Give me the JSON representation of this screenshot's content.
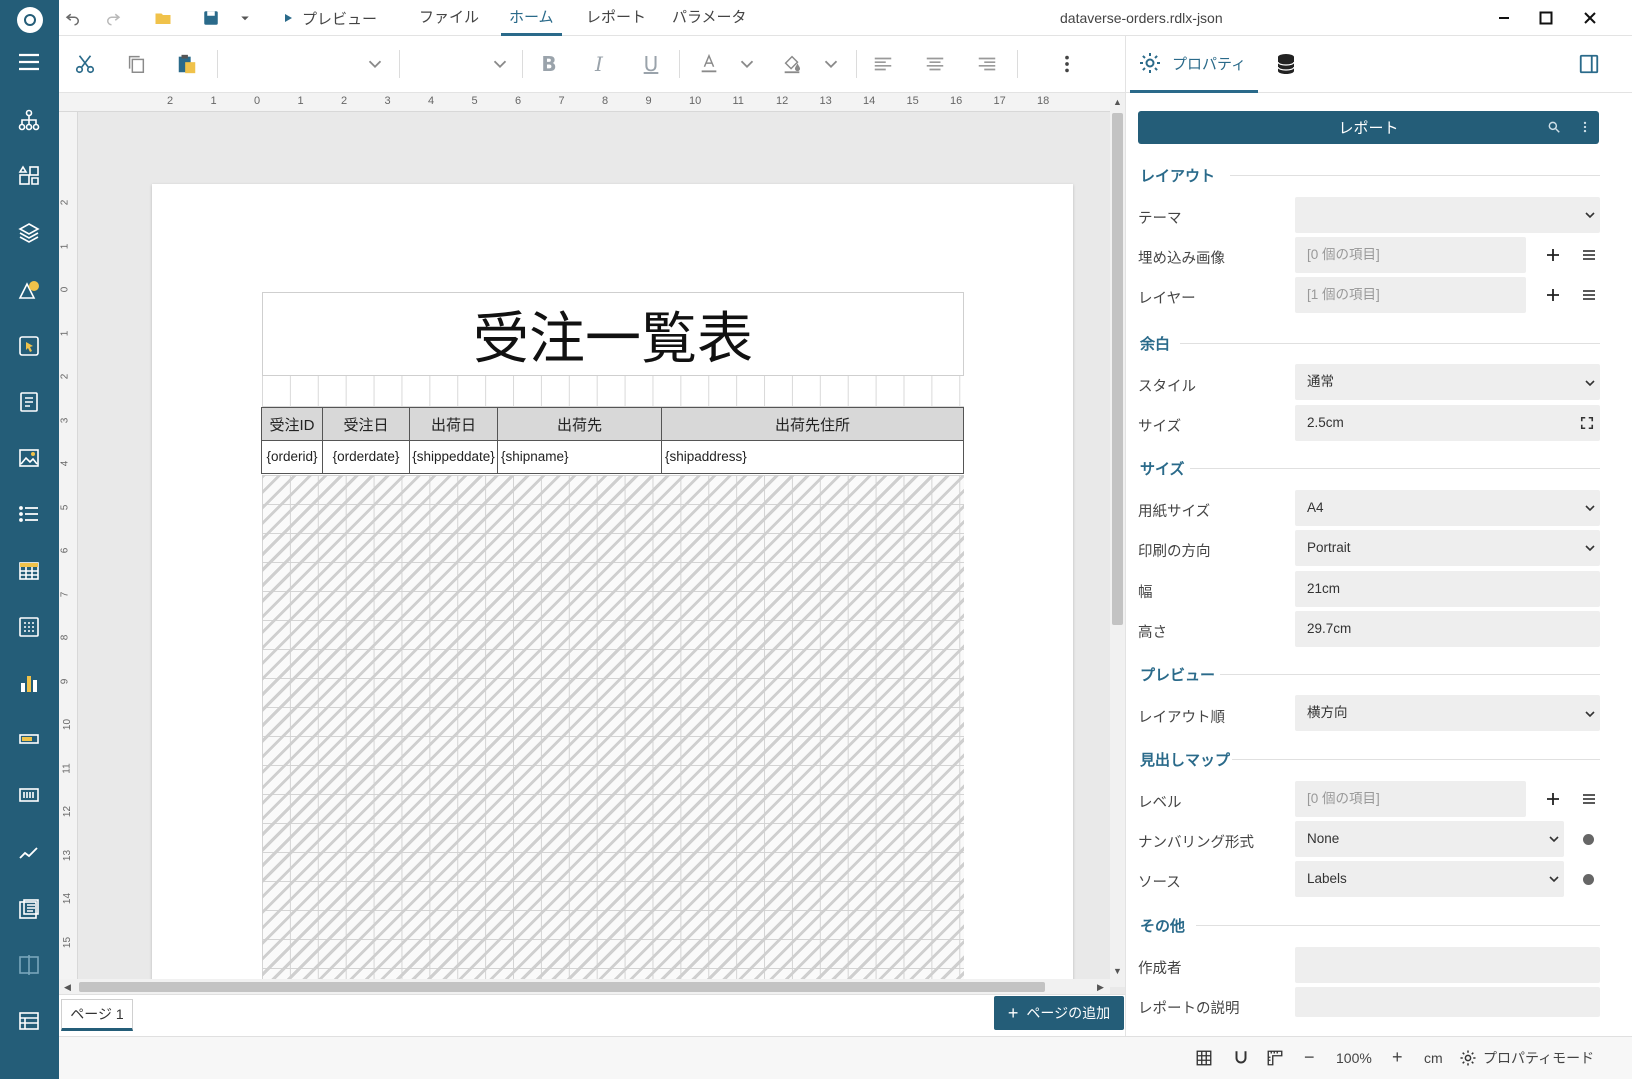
{
  "window": {
    "title": "dataverse-orders.rdlx-json",
    "preview_label": "プレビュー"
  },
  "menu": {
    "items": [
      {
        "label": "ファイル",
        "active": false
      },
      {
        "label": "ホーム",
        "active": true
      },
      {
        "label": "レポート",
        "active": false
      },
      {
        "label": "パラメータ",
        "active": false
      }
    ]
  },
  "ruler": {
    "h_ticks": [
      "2",
      "1",
      "0",
      "1",
      "2",
      "3",
      "4",
      "5",
      "6",
      "7",
      "8",
      "9",
      "10",
      "11",
      "12",
      "13",
      "14",
      "15",
      "16",
      "17",
      "18"
    ],
    "v_ticks": [
      "2",
      "1",
      "0",
      "1",
      "2",
      "3",
      "4",
      "5",
      "6",
      "7",
      "8",
      "9",
      "10",
      "11",
      "12",
      "13",
      "14",
      "15"
    ]
  },
  "report": {
    "title": "受注一覧表",
    "headers": [
      "受注ID",
      "受注日",
      "出荷日",
      "出荷先",
      "出荷先住所"
    ],
    "row": [
      "{orderid}",
      "{orderdate}",
      "{shippeddate}",
      "{shipname}",
      "{shipaddress}"
    ]
  },
  "pages": {
    "tab_label": "ページ 1",
    "add_label": "ページの追加"
  },
  "panel": {
    "tab_label": "プロパティ",
    "object_label": "レポート",
    "sections": {
      "layout": "レイアウト",
      "margin": "余白",
      "size": "サイズ",
      "preview": "プレビュー",
      "bookmarks": "見出しマップ",
      "other": "その他"
    },
    "props": {
      "theme": {
        "label": "テーマ",
        "value": ""
      },
      "embedded_images": {
        "label": "埋め込み画像",
        "value": "[0 個の項目]"
      },
      "layers": {
        "label": "レイヤー",
        "value": "[1 個の項目]"
      },
      "margin_style": {
        "label": "スタイル",
        "value": "通常"
      },
      "margin_size": {
        "label": "サイズ",
        "value": "2.5cm"
      },
      "paper_size": {
        "label": "用紙サイズ",
        "value": "A4"
      },
      "orientation": {
        "label": "印刷の方向",
        "value": "Portrait"
      },
      "width": {
        "label": "幅",
        "value": "21cm"
      },
      "height": {
        "label": "高さ",
        "value": "29.7cm"
      },
      "layout_order": {
        "label": "レイアウト順",
        "value": "横方向"
      },
      "level": {
        "label": "レベル",
        "value": "[0 個の項目]"
      },
      "numbering": {
        "label": "ナンバリング形式",
        "value": "None"
      },
      "source": {
        "label": "ソース",
        "value": "Labels"
      },
      "author": {
        "label": "作成者",
        "value": ""
      },
      "description": {
        "label": "レポートの説明",
        "value": ""
      }
    }
  },
  "status": {
    "zoom": "100%",
    "unit": "cm",
    "mode_label": "プロパティモード"
  },
  "colors": {
    "rail": "#245d78",
    "accent": "#2a6a8a"
  }
}
